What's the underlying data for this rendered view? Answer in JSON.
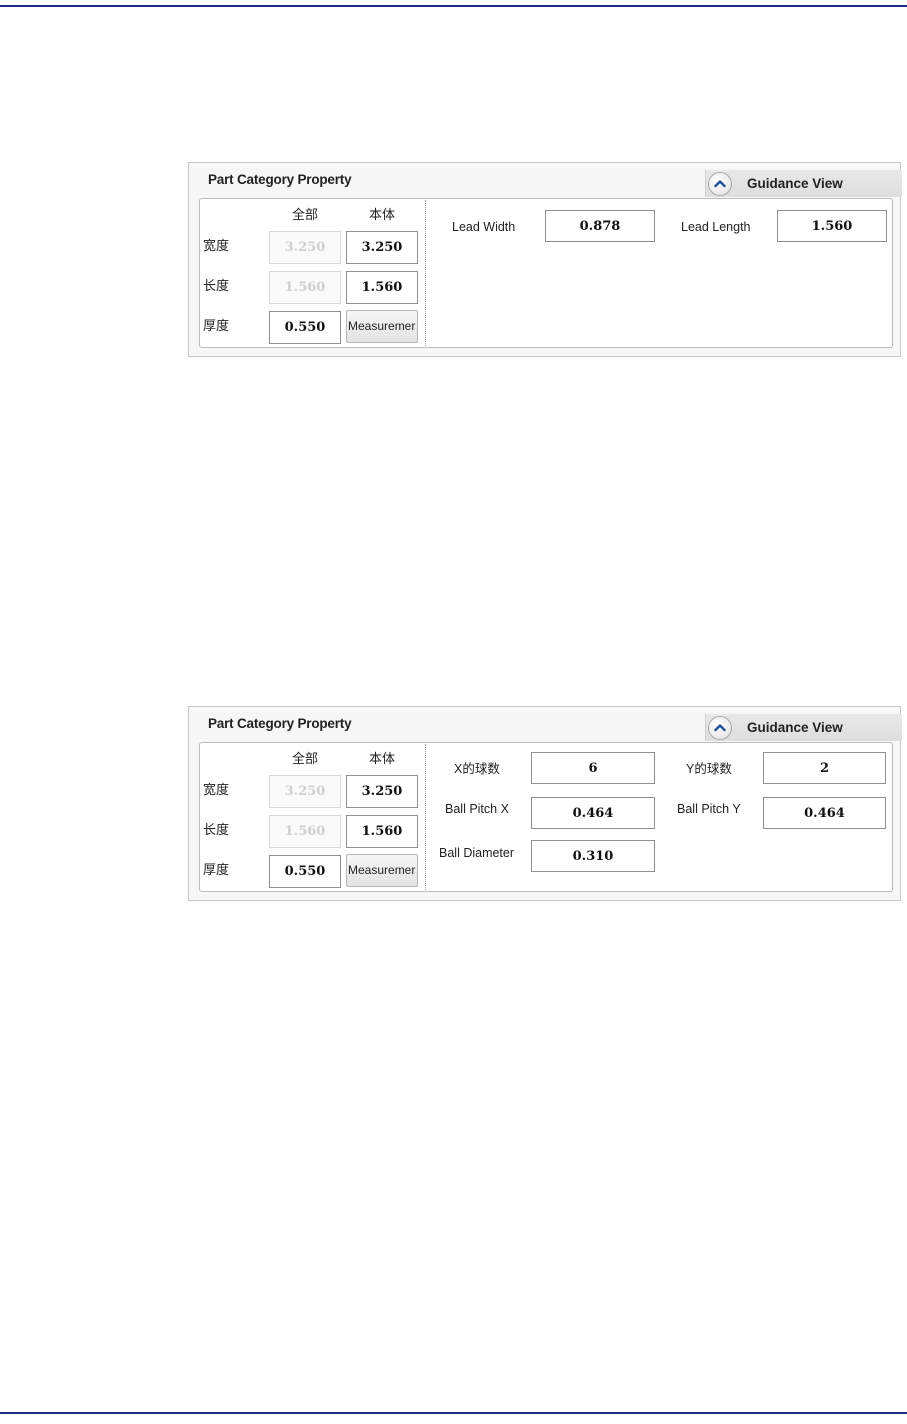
{
  "panels": [
    {
      "title": "Part Category Property",
      "guidance_label": "Guidance View",
      "dims": {
        "col_all": "全部",
        "col_body": "本体",
        "width_label": "宽度",
        "length_label": "长度",
        "thickness_label": "厚度",
        "width_all": "3.250",
        "width_body": "3.250",
        "length_all": "1.560",
        "length_body": "1.560",
        "thickness_all": "0.550",
        "measure_button": "Measuremer"
      },
      "fields": {
        "lead_width_label": "Lead Width",
        "lead_width_value": "0.878",
        "lead_length_label": "Lead Length",
        "lead_length_value": "1.560"
      }
    },
    {
      "title": "Part Category Property",
      "guidance_label": "Guidance View",
      "dims": {
        "col_all": "全部",
        "col_body": "本体",
        "width_label": "宽度",
        "length_label": "长度",
        "thickness_label": "厚度",
        "width_all": "3.250",
        "width_body": "3.250",
        "length_all": "1.560",
        "length_body": "1.560",
        "thickness_all": "0.550",
        "measure_button": "Measuremer"
      },
      "fields": {
        "x_balls_label": "X的球数",
        "x_balls_value": "6",
        "y_balls_label": "Y的球数",
        "y_balls_value": "2",
        "pitch_x_label": "Ball Pitch X",
        "pitch_x_value": "0.464",
        "pitch_y_label": "Ball Pitch Y",
        "pitch_y_value": "0.464",
        "diameter_label": "Ball Diameter",
        "diameter_value": "0.310"
      }
    }
  ],
  "icons": {
    "guidance_toggle": "chevron-up-icon"
  },
  "colors": {
    "rule": "#1f2d8a",
    "chevron": "#1c4f9c"
  }
}
